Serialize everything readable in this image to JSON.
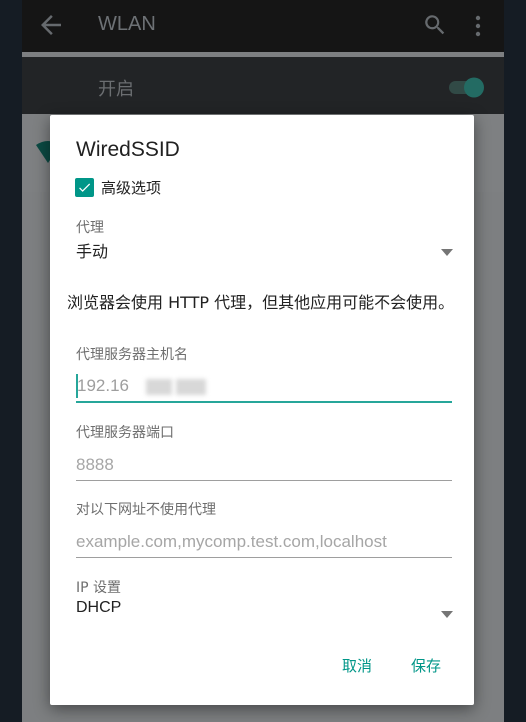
{
  "toolbar": {
    "title": "WLAN",
    "back_icon": "back-arrow-icon",
    "search_icon": "search-icon",
    "more_icon": "more-vert-icon"
  },
  "wlan_switch": {
    "label": "开启",
    "state": true
  },
  "dialog": {
    "title": "WiredSSID",
    "advanced": {
      "label": "高级选项",
      "checked": true
    },
    "proxy": {
      "caption": "代理",
      "value": "手动"
    },
    "note": "浏览器会使用 HTTP 代理，但其他应用可能不会使用。",
    "proxy_host": {
      "caption": "代理服务器主机名",
      "value": "192.16"
    },
    "proxy_port": {
      "caption": "代理服务器端口",
      "placeholder": "8888"
    },
    "bypass": {
      "caption": "对以下网址不使用代理",
      "placeholder": "example.com,mycomp.test.com,localhost"
    },
    "ip_settings": {
      "caption": "IP 设置",
      "value": "DHCP"
    },
    "cancel_label": "取消",
    "save_label": "保存"
  },
  "colors": {
    "accent": "#009688",
    "focus_underline": "#26a69a"
  }
}
